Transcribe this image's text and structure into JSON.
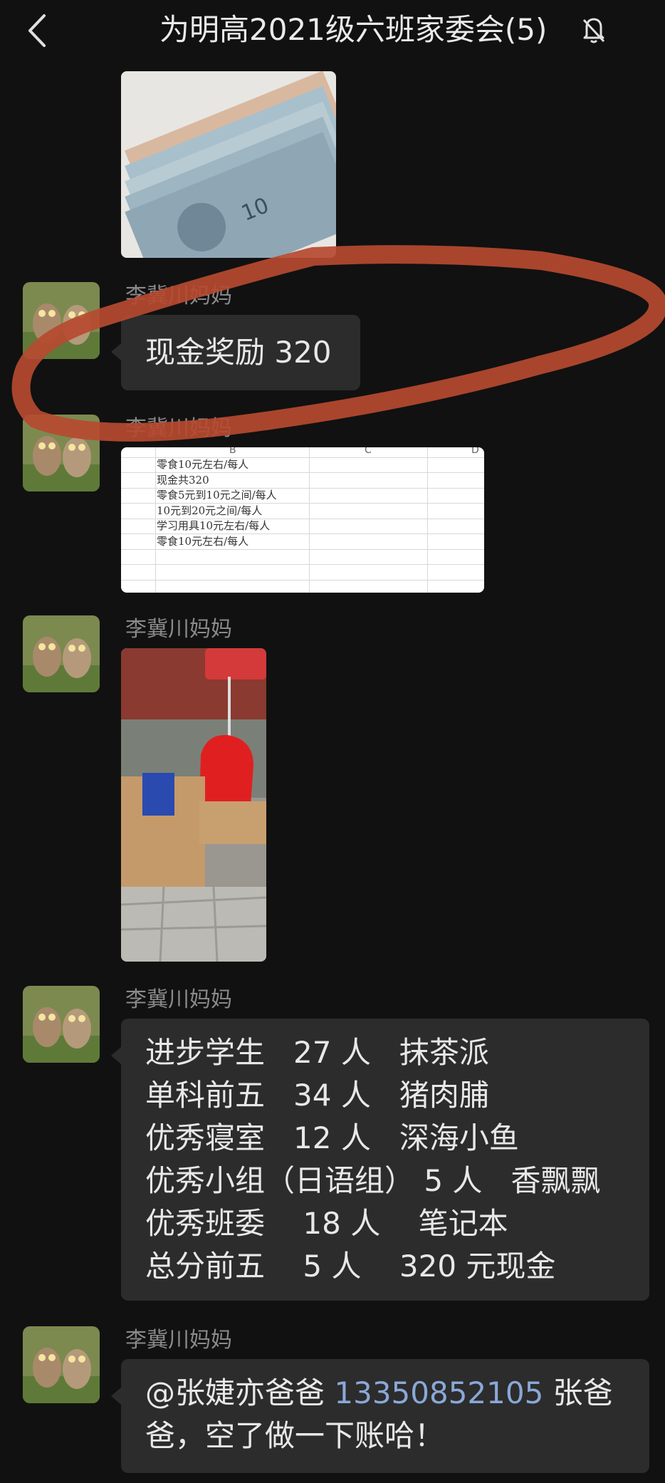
{
  "header": {
    "title": "为明高2021级六班家委会(5)",
    "back_icon": "chevron-left-icon",
    "mute_icon": "bell-off-icon"
  },
  "messages": [
    {
      "type": "image",
      "content": "banknotes-photo"
    },
    {
      "sender": "李冀川妈妈",
      "type": "text",
      "text": "现金奖励 320"
    },
    {
      "sender": "李冀川妈妈",
      "type": "image",
      "spreadsheet": {
        "columns": [
          "B",
          "C",
          "D"
        ],
        "rows": [
          "零食10元左右/每人",
          "现金共320",
          "零食5元到10元之间/每人",
          "10元到20元之间/每人",
          "学习用具10元左右/每人",
          "零食10元左右/每人"
        ]
      }
    },
    {
      "sender": "李冀川妈妈",
      "type": "image",
      "content": "gift-boxes-photo"
    },
    {
      "sender": "李冀川妈妈",
      "type": "text",
      "lines": [
        "进步学生   27 人   抹茶派",
        "单科前五   34 人   猪肉脯",
        "优秀寝室   12 人   深海小鱼",
        "优秀小组（日语组） 5 人   香飘飘",
        "优秀班委    18 人    笔记本",
        "总分前五    5 人    320 元现金"
      ]
    },
    {
      "sender": "李冀川妈妈",
      "type": "text",
      "mention": "@张婕亦爸爸",
      "phone": "13350852105",
      "line1_rest": " 张爸",
      "line2": "爸，空了做一下账哈！"
    }
  ],
  "colors": {
    "background": "#111111",
    "bubble": "#2c2c2c",
    "annotation": "#b64a30",
    "link": "#8aa8d8"
  }
}
